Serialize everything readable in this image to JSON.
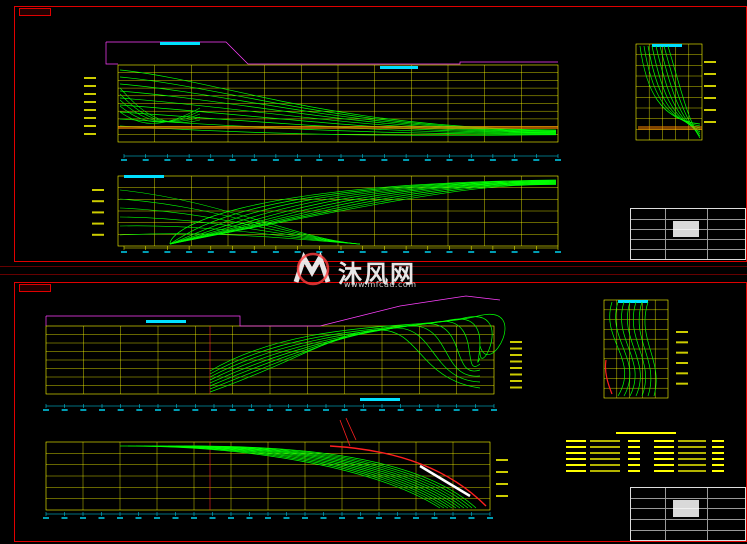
{
  "watermark": {
    "chinese": "沐风网",
    "url": "www.mfcad.com"
  },
  "colors": {
    "background": "#000000",
    "frame": "#e00000",
    "grid": "#ffff00",
    "curves": "#00ff00",
    "labels": "#00e0ff",
    "annotation": "#ff40ff",
    "accent": "#ff8800",
    "red_curves": "#ff2020"
  },
  "icons": {
    "watermark_logo": "mfcad-logo-icon"
  }
}
